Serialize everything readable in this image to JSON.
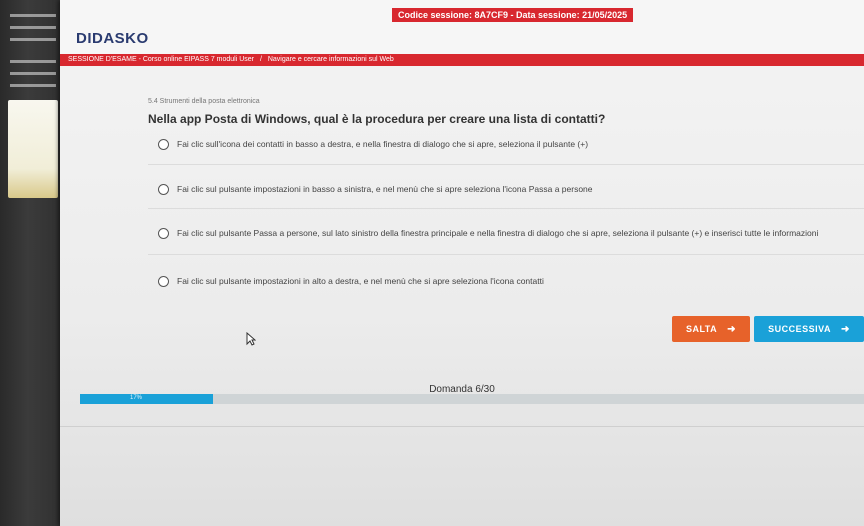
{
  "header": {
    "logo": "DIDASKO",
    "session_info": "Codice sessione: 8A7CF9 - Data sessione: 21/05/2025",
    "breadcrumb": [
      "SESSIONE D'ESAME - Corso online EIPASS 7 moduli User",
      "Navigare e cercare informazioni sul Web"
    ],
    "separator": "/"
  },
  "question": {
    "module": "5.4 Strumenti della posta elettronica",
    "text": "Nella app Posta di Windows, qual è la procedura per creare una lista di contatti?",
    "options": [
      "Fai clic sull'icona dei contatti in basso a destra, e nella finestra di dialogo che si apre, seleziona il pulsante (+)",
      "Fai clic sul pulsante impostazioni in basso a sinistra, e nel menù che si apre seleziona l'icona Passa a persone",
      "Fai clic sul pulsante Passa a persone, sul lato sinistro della finestra principale e nella finestra di dialogo che si apre, seleziona il pulsante (+) e inserisci tutte le informazioni",
      "Fai clic sul pulsante impostazioni in alto a destra, e nel menù che si apre seleziona l'icona contatti"
    ]
  },
  "actions": {
    "skip_label": "SALTA",
    "next_label": "SUCCESSIVA",
    "arrow_icon": "arrow-right-icon"
  },
  "progress": {
    "label": "Domanda 6/30",
    "percent_text": "17%",
    "fraction": 0.17
  },
  "colors": {
    "brand": "#2a3b70",
    "header_bar": "#d8282f",
    "skip": "#e7622a",
    "next": "#1aa1d8"
  }
}
